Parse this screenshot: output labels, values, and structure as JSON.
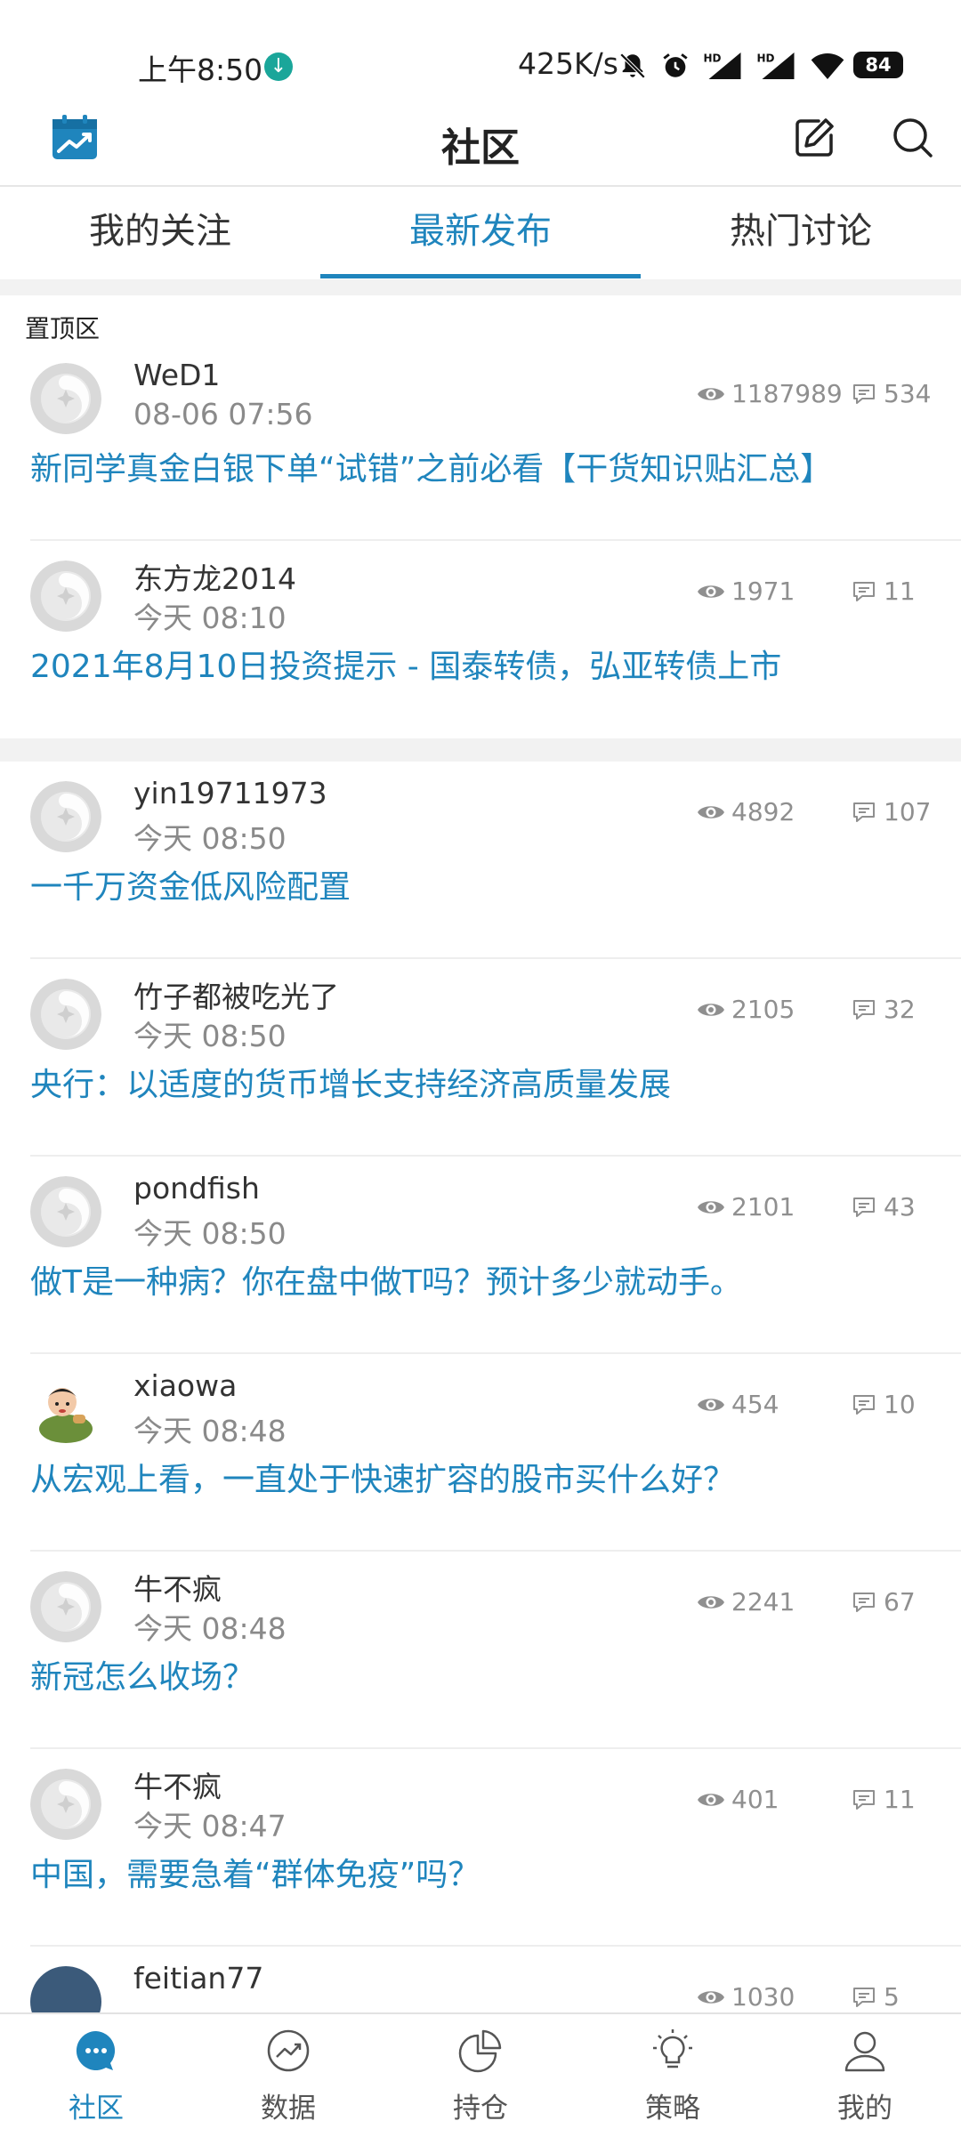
{
  "status_bar": {
    "time": "上午8:50",
    "speed": "425K/s",
    "battery": "84",
    "icons": [
      "download-icon",
      "bell-off-icon",
      "alarm-icon",
      "hd-signal-icon",
      "hd-signal-icon",
      "wifi-icon",
      "battery-icon"
    ]
  },
  "header": {
    "title": "社区",
    "icons": [
      "calendar-chart-icon",
      "edit-icon",
      "search-icon"
    ],
    "accent_color": "#1f85bd"
  },
  "tabs": [
    {
      "label": "我的关注"
    },
    {
      "label": "最新发布"
    },
    {
      "label": "热门讨论"
    }
  ],
  "active_tab": "最新发布",
  "pinned": {
    "label": "置顶区",
    "posts": [
      {
        "author": "WeD1",
        "time": "08-06 07:56",
        "views": "1187989",
        "comments": "534",
        "title": "新同学真金白银下单“试错”之前必看【干货知识贴汇总】"
      },
      {
        "author": "东方龙2014",
        "time": "今天 08:10",
        "views": "1971",
        "comments": "11",
        "title": "2021年8月10日投资提示 - 国泰转债，弘亚转债上市"
      }
    ]
  },
  "posts": [
    {
      "author": "yin19711973",
      "time": "今天 08:50",
      "views": "4892",
      "comments": "107",
      "title": "一千万资金低风险配置"
    },
    {
      "author": "竹子都被吃光了",
      "time": "今天 08:50",
      "views": "2105",
      "comments": "32",
      "title": "央行：以适度的货币增长支持经济高质量发展"
    },
    {
      "author": "pondfish",
      "time": "今天 08:50",
      "views": "2101",
      "comments": "43",
      "title": "做T是一种病？你在盘中做T吗？预计多少就动手。"
    },
    {
      "author": "xiaowa",
      "time": "今天 08:48",
      "views": "454",
      "comments": "10",
      "title": "从宏观上看，一直处于快速扩容的股市买什么好？"
    },
    {
      "author": "牛不疯",
      "time": "今天 08:48",
      "views": "2241",
      "comments": "67",
      "title": "新冠怎么收场？"
    },
    {
      "author": "牛不疯",
      "time": "今天 08:47",
      "views": "401",
      "comments": "11",
      "title": "中国，需要急着“群体免疫”吗？"
    },
    {
      "author": "feitian77",
      "time": "",
      "views": "1030",
      "comments": "5",
      "title": ""
    }
  ],
  "bottom_nav": [
    {
      "label": "社区",
      "icon": "chat-bubble-icon"
    },
    {
      "label": "数据",
      "icon": "trend-chart-icon"
    },
    {
      "label": "持仓",
      "icon": "pie-chart-icon"
    },
    {
      "label": "策略",
      "icon": "lightbulb-icon"
    },
    {
      "label": "我的",
      "icon": "user-icon"
    }
  ]
}
